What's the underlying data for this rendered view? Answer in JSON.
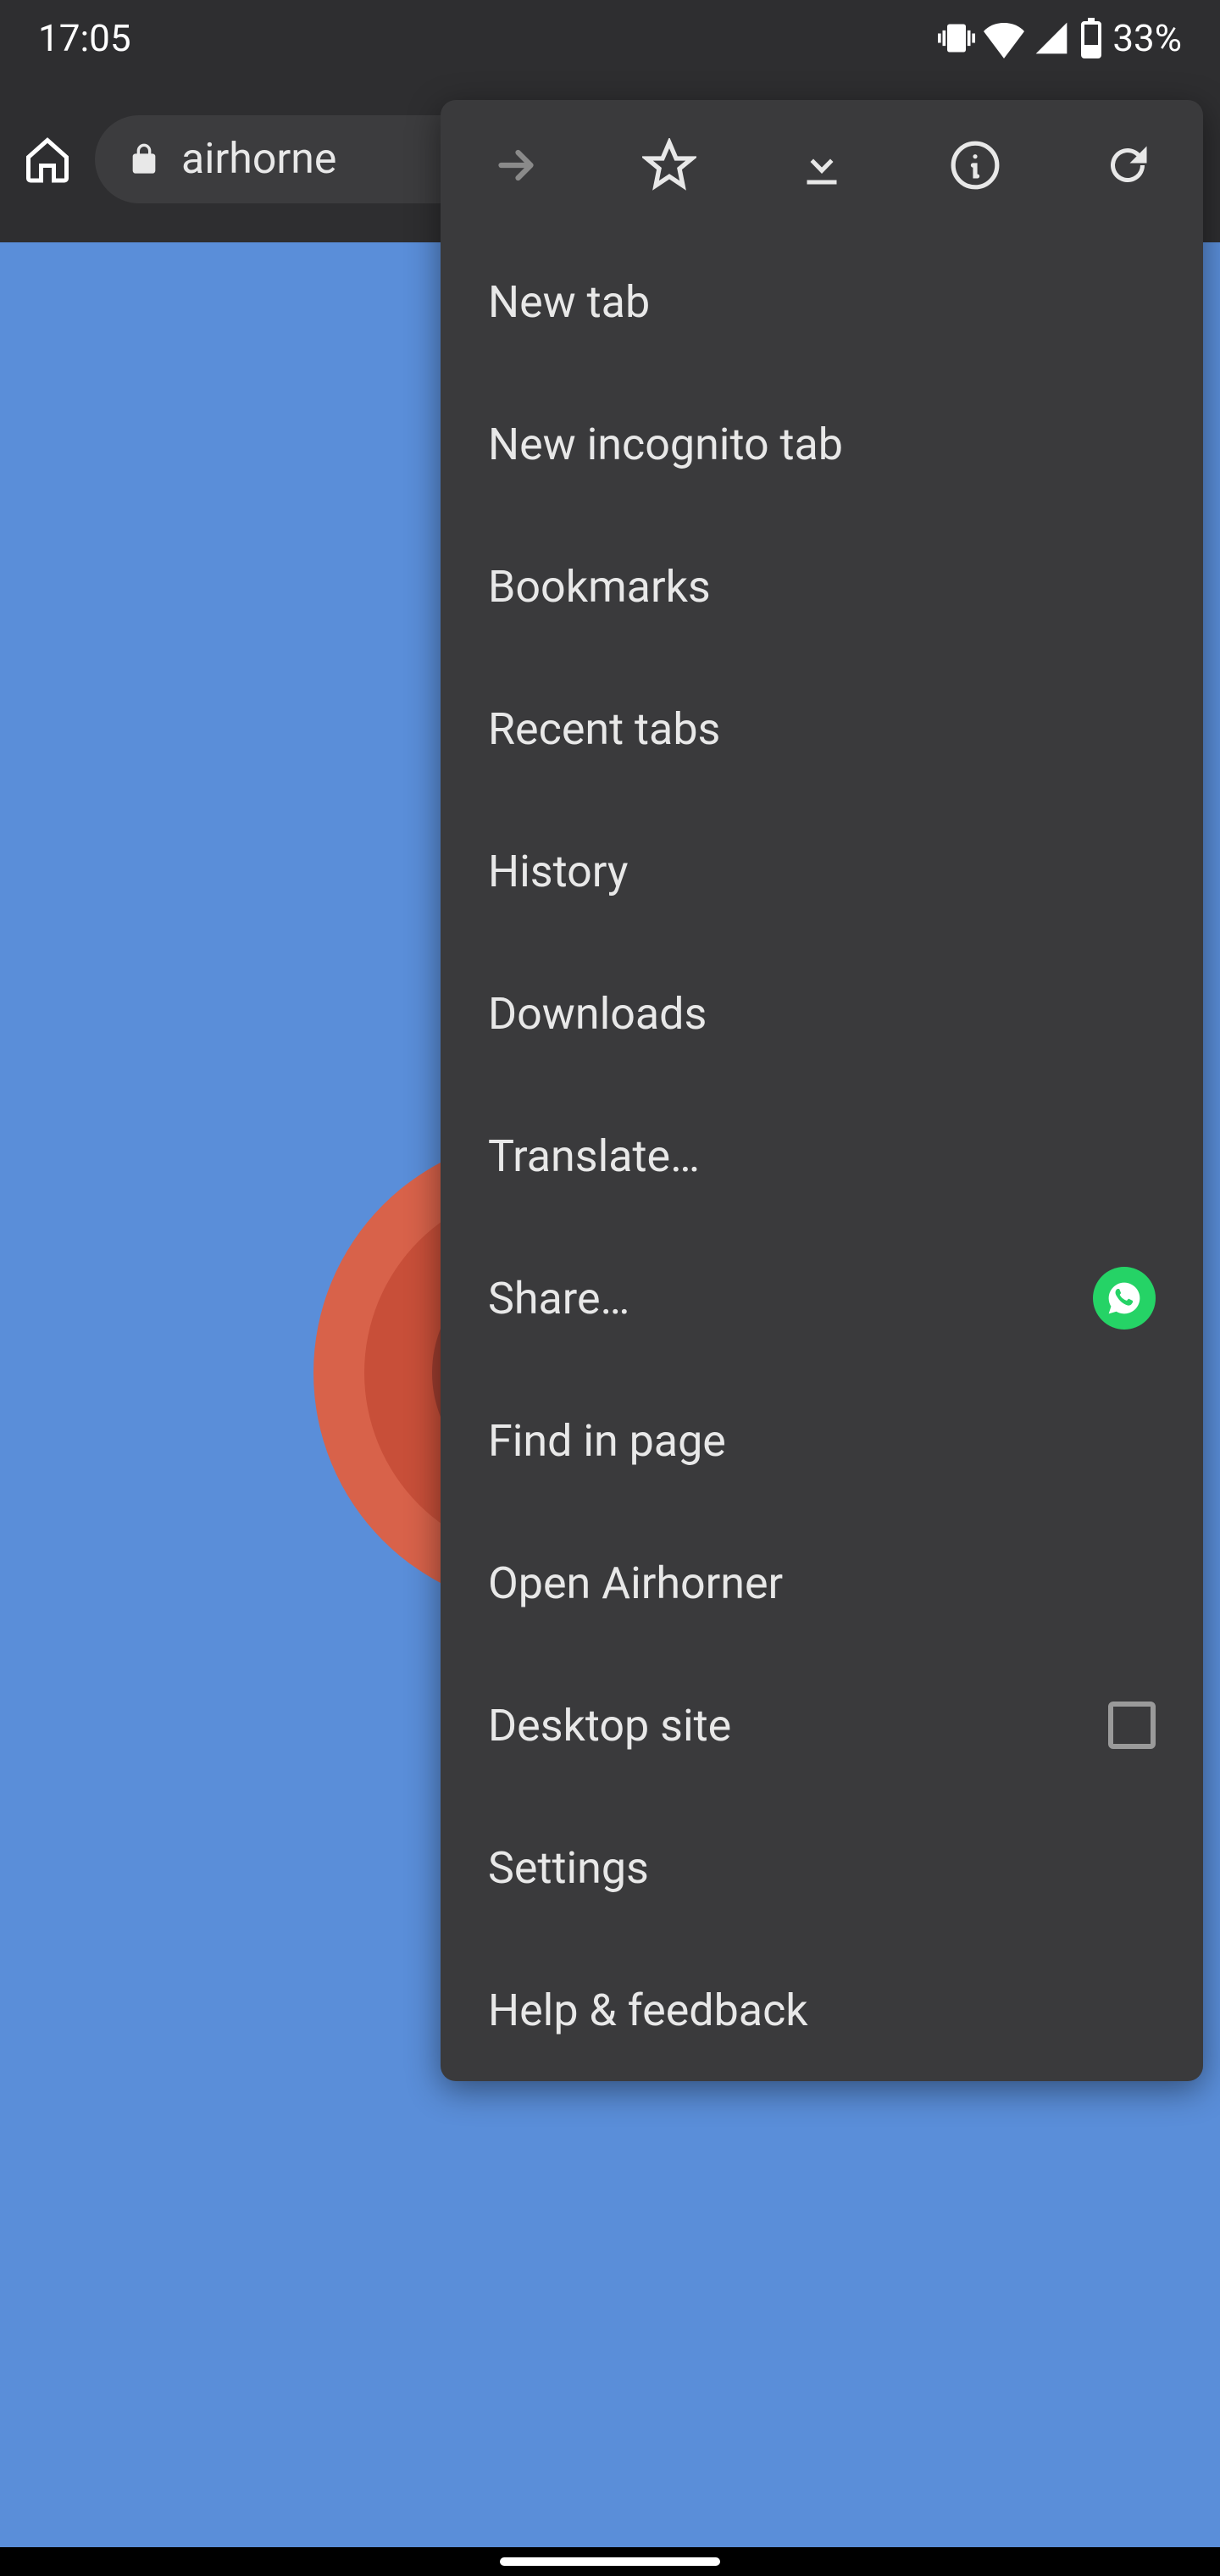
{
  "status": {
    "time": "17:05",
    "battery": "33%"
  },
  "url": {
    "text": "airhorne"
  },
  "menu": {
    "items": [
      "New tab",
      "New incognito tab",
      "Bookmarks",
      "Recent tabs",
      "History",
      "Downloads",
      "Translate…",
      "Share…",
      "Find in page",
      "Open Airhorner",
      "Desktop site",
      "Settings",
      "Help & feedback"
    ]
  }
}
